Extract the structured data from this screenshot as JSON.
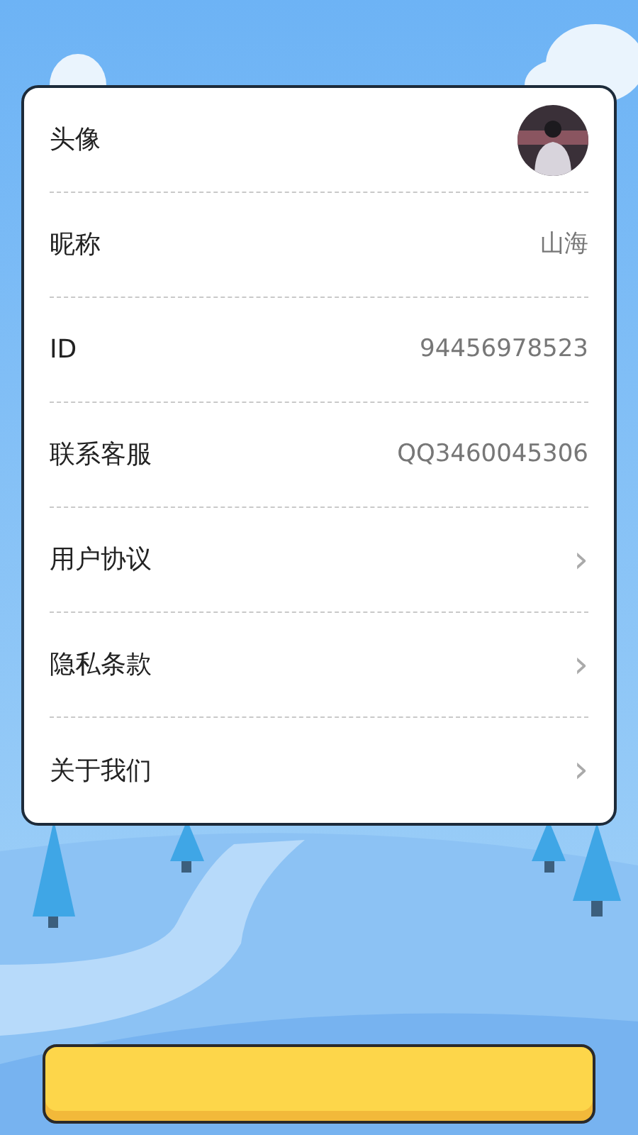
{
  "settings": [
    {
      "kind": "avatar",
      "label": "头像"
    },
    {
      "kind": "value",
      "label": "昵称",
      "value": "山海"
    },
    {
      "kind": "value",
      "label": "ID",
      "value": "94456978523"
    },
    {
      "kind": "value",
      "label": "联系客服",
      "value": "QQ3460045306"
    },
    {
      "kind": "link",
      "label": "用户协议",
      "chevron": "›"
    },
    {
      "kind": "link",
      "label": "隐私条款",
      "chevron": "›"
    },
    {
      "kind": "link",
      "label": "关于我们",
      "chevron": "›"
    }
  ],
  "bottom_button": {
    "kind": "button"
  }
}
